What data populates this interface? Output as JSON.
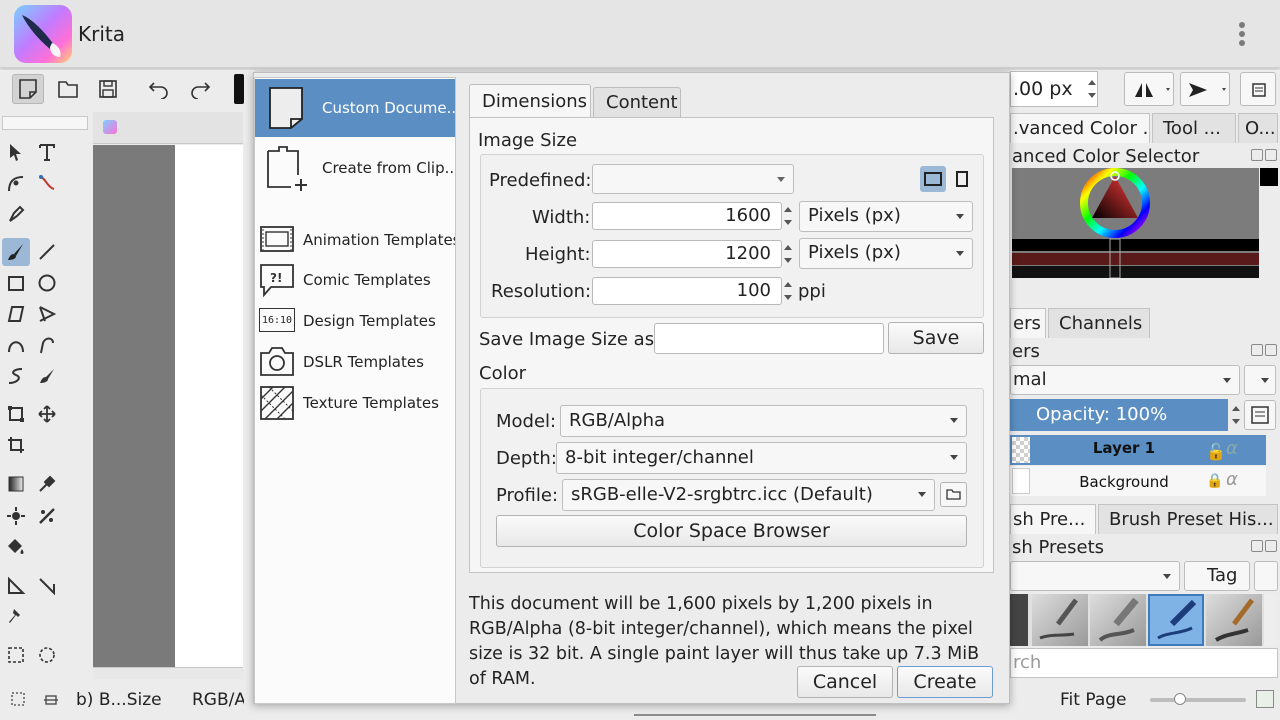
{
  "app": {
    "title": "Krita"
  },
  "right_dock": {
    "size_field": ".00 px",
    "tabs_top": [
      ".vanced Color ...",
      "Tool ...",
      "O..."
    ],
    "color_selector_title": "anced Color Selector",
    "tabs_mid": [
      "ers",
      "Channels"
    ],
    "layers_title": "ers",
    "blend_mode": "mal",
    "opacity": "Opacity:  100%",
    "layers": [
      "Layer 1",
      "Background"
    ],
    "tabs_brush": [
      "sh Pre...",
      "Brush Preset His..."
    ],
    "brush_presets_title": "sh Presets",
    "tag_button": "Tag",
    "search_placeholder": "rch",
    "fit_page": "Fit Page"
  },
  "status": {
    "brush": "b) B...Size",
    "color": "RGB/A"
  },
  "dialog": {
    "sidebar": {
      "custom": "Custom Docume...",
      "clipboard": "Create from Clip...",
      "items": [
        "Animation Templates",
        "Comic Templates",
        "Design Templates",
        "DSLR Templates",
        "Texture Templates"
      ]
    },
    "tabs": [
      "Dimensions",
      "Content"
    ],
    "image_size": {
      "section": "Image Size",
      "predefined_label": "Predefined:",
      "predefined_value": "",
      "width_label": "Width:",
      "width_value": "1600",
      "width_unit": "Pixels (px)",
      "height_label": "Height:",
      "height_value": "1200",
      "height_unit": "Pixels (px)",
      "resolution_label": "Resolution:",
      "resolution_value": "100",
      "resolution_unit": "ppi"
    },
    "save_size": {
      "label": "Save Image Size as:",
      "value": "",
      "button": "Save"
    },
    "color": {
      "section": "Color",
      "model_label": "Model:",
      "model_value": "RGB/Alpha",
      "depth_label": "Depth:",
      "depth_value": "8-bit integer/channel",
      "profile_label": "Profile:",
      "profile_value": "sRGB-elle-V2-srgbtrc.icc (Default)",
      "browser_button": "Color Space Browser"
    },
    "description": "This document will be 1,600 pixels by 1,200 pixels in RGB/Alpha (8-bit integer/channel), which means the pixel size is 32 bit. A single paint layer will thus take up 7.3 MiB of RAM.",
    "cancel": "Cancel",
    "create": "Create",
    "design_icon_text": "16:10"
  },
  "colors": {
    "accent": "#5b8fc3",
    "selection": "#5b8fc3"
  }
}
